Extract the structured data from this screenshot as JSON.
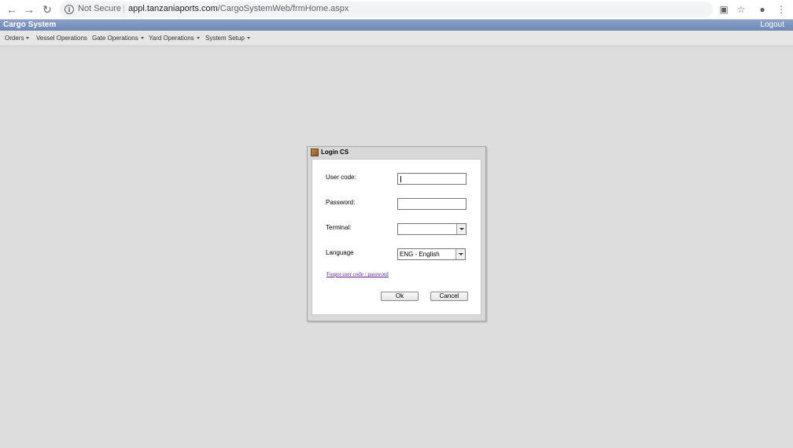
{
  "browser": {
    "security_label": "Not Secure",
    "separator": "|",
    "url_domain": "appl.tanzaniaports.com",
    "url_path": "/CargoSystemWeb/frmHome.aspx",
    "icons": [
      "back-arrow-icon",
      "forward-arrow-icon",
      "reload-icon",
      "info-icon",
      "translate-icon",
      "star-icon",
      "extension-icon",
      "kebab-menu-icon"
    ]
  },
  "app": {
    "title": "Cargo System",
    "logout_label": "Logout",
    "header_color": "#7189b8"
  },
  "menu": {
    "items": [
      {
        "label": "Orders",
        "has_dropdown": true
      },
      {
        "label": "Vessel Operations",
        "has_dropdown": false
      },
      {
        "label": "Gate Operations",
        "has_dropdown": true
      },
      {
        "label": "Yard Operations",
        "has_dropdown": true
      },
      {
        "label": "System Setup",
        "has_dropdown": true
      }
    ]
  },
  "login_dialog": {
    "title": "Login CS",
    "fields": {
      "user_code_label": "User code:",
      "user_code_value": "",
      "password_label": "Password:",
      "password_value": "",
      "terminal_label": "Terminal:",
      "terminal_value": "",
      "language_label": "Language",
      "language_value": "ENG - English"
    },
    "forgot_link": "Forgot user code / password",
    "ok_label": "Ok",
    "cancel_label": "Cancel"
  }
}
